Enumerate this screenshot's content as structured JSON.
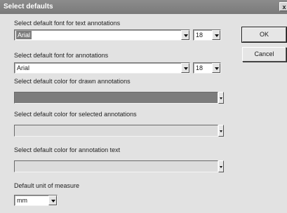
{
  "window": {
    "title": "Select defaults",
    "close_glyph": "x"
  },
  "text_font": {
    "label": "Select default font for text annotations",
    "font": "Arial",
    "size": "18"
  },
  "annotation_font": {
    "label": "Select default font for annotations",
    "font": "Arial",
    "size": "18"
  },
  "drawn_color": {
    "label": "Select default color for drawn annotations",
    "color": "#7c7c7c"
  },
  "selected_color": {
    "label": "Select default color for selected annotations",
    "color": "#dcdcdc"
  },
  "text_color": {
    "label": "Select default color for annotation text",
    "color": "#dcdcdc"
  },
  "unit": {
    "label": "Default unit of measure",
    "value": "mm"
  },
  "buttons": {
    "ok": "OK",
    "cancel": "Cancel"
  }
}
